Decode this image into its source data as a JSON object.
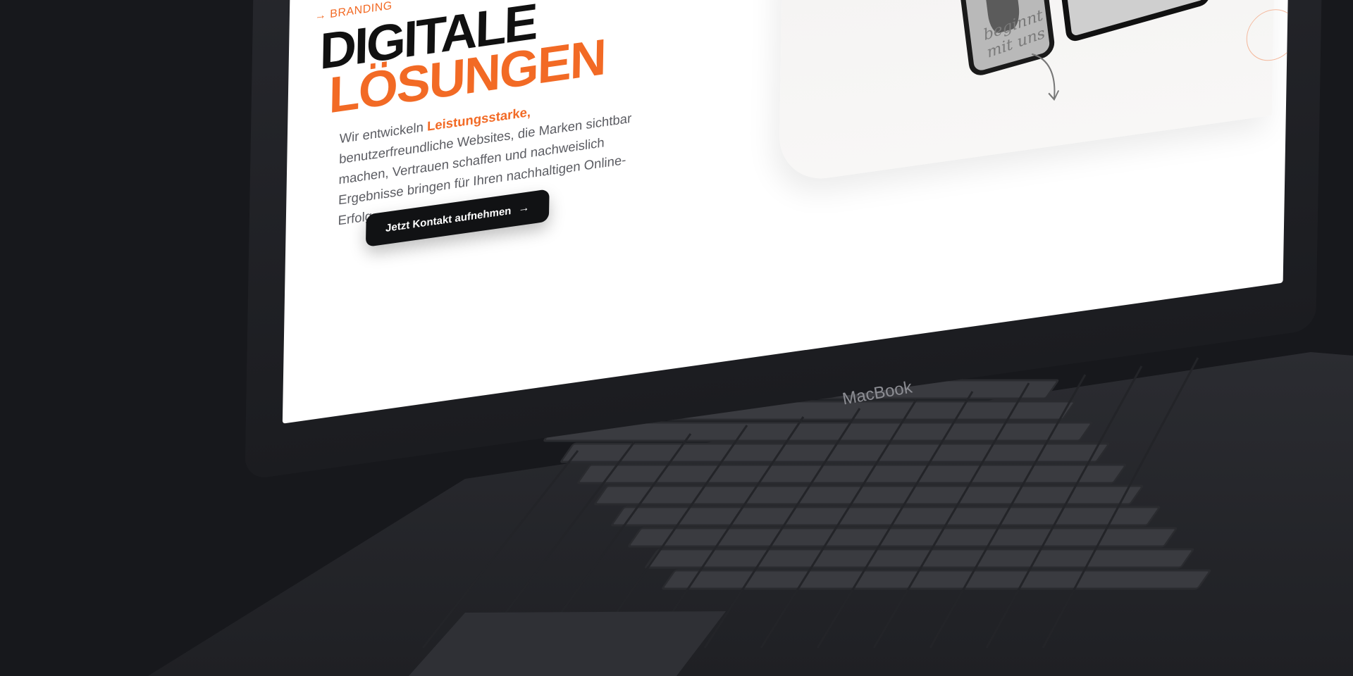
{
  "page": {
    "crumb": "→ BRANDING",
    "headline_line1": "DIGITALE",
    "headline_line2": "LÖSUNGEN",
    "body_prefix": "Wir entwickeln ",
    "body_highlight": "Leistungsstarke,",
    "body_rest": " benutzerfreundliche Websites, die Marken sichtbar machen, Vertrauen schaffen und nachweislich Ergebnisse bringen für Ihren nachhaltigen Online-Erfolg.",
    "cta_label": "Jetzt Kontakt aufnehmen",
    "cta_arrow": "→",
    "script_note": "beginnt\nmit uns"
  },
  "device": {
    "brand": "MacBook"
  },
  "colors": {
    "accent": "#f26a25",
    "background": "#17181c",
    "screen": "#ffffff",
    "text_dark": "#111111"
  },
  "icons": {
    "arrow": "arrow-right-icon",
    "hand_arrow": "hand-drawn-arrow-icon"
  }
}
